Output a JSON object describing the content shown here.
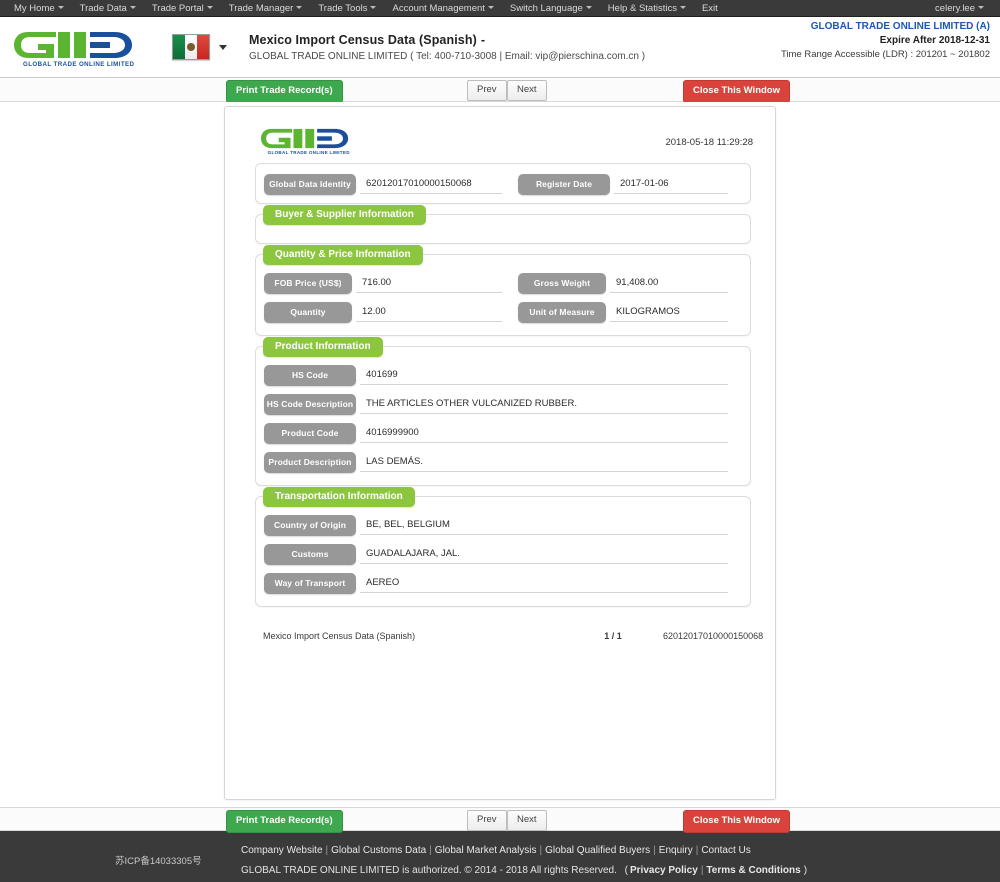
{
  "topnav": {
    "items": [
      {
        "label": "My Home",
        "caret": true
      },
      {
        "label": "Trade Data",
        "caret": true
      },
      {
        "label": "Trade Portal",
        "caret": true
      },
      {
        "label": "Trade Manager",
        "caret": true
      },
      {
        "label": "Trade Tools",
        "caret": true
      },
      {
        "label": "Account Management",
        "caret": true
      },
      {
        "label": "Switch Language",
        "caret": true
      },
      {
        "label": "Help & Statistics",
        "caret": true
      },
      {
        "label": "Exit",
        "caret": false
      }
    ],
    "user": "celery.lee"
  },
  "header": {
    "logo_text": "GLOBAL TRADE ONLINE LIMITED",
    "flag": "mexico-flag",
    "title": "Mexico Import Census Data (Spanish)",
    "title_dash": "-",
    "subtitle": "GLOBAL TRADE ONLINE LIMITED ( Tel: 400-710-3008 | Email: vip@pierschina.com.cn )",
    "account_name": "GLOBAL TRADE ONLINE LIMITED (A)",
    "expire": "Expire After 2018-12-31",
    "time_range": "Time Range Accessible (LDR) : 201201 ~ 201802"
  },
  "toolbar": {
    "print_label": "Print Trade Record(s)",
    "prev_label": "Prev",
    "next_label": "Next",
    "close_label": "Close This Window"
  },
  "sheet": {
    "logo_text": "GLOBAL TRADE ONLINE LIMITED",
    "timestamp": "2018-05-18 11:29:28",
    "identity": {
      "id_label": "Global Data Identity",
      "id_value": "62012017010000150068",
      "date_label": "Register Date",
      "date_value": "2017-01-06"
    },
    "sections": [
      {
        "title": "Buyer & Supplier Information",
        "rows": []
      },
      {
        "title": "Quantity & Price Information",
        "rows": [
          [
            {
              "label": "FOB Price (US$)",
              "value": "716.00"
            },
            {
              "label": "Gross Weight",
              "value": "91,408.00"
            }
          ],
          [
            {
              "label": "Quantity",
              "value": "12.00"
            },
            {
              "label": "Unit of Measure",
              "value": "KILOGRAMOS"
            }
          ]
        ]
      },
      {
        "title": "Product Information",
        "rows": [
          [
            {
              "label": "HS Code",
              "value": "401699"
            }
          ],
          [
            {
              "label": "HS Code Description",
              "value": "THE ARTICLES OTHER VULCANIZED RUBBER."
            }
          ],
          [
            {
              "label": "Product Code",
              "value": "4016999900"
            }
          ],
          [
            {
              "label": "Product Description",
              "value": "LAS DEMÁS."
            }
          ]
        ]
      },
      {
        "title": "Transportation Information",
        "rows": [
          [
            {
              "label": "Country of Origin",
              "value": "BE, BEL, BELGIUM"
            }
          ],
          [
            {
              "label": "Customs",
              "value": "GUADALAJARA, JAL."
            }
          ],
          [
            {
              "label": "Way of Transport",
              "value": "AEREO"
            }
          ]
        ]
      }
    ],
    "footer": {
      "source": "Mexico Import Census Data (Spanish)",
      "page": "1 / 1",
      "identity": "62012017010000150068"
    }
  },
  "footer": {
    "icp": "苏ICP备14033305号",
    "links": [
      "Company Website",
      "Global Customs Data",
      "Global Market Analysis",
      "Global Qualified Buyers",
      "Enquiry",
      "Contact Us"
    ],
    "copyright": "GLOBAL TRADE ONLINE LIMITED is authorized. © 2014 - 2018 All rights Reserved.",
    "legal_open": "(",
    "privacy": "Privacy Policy",
    "legal_sep": "|",
    "terms": "Terms & Conditions",
    "legal_close": ")"
  },
  "colors": {
    "green": "#8cc63e",
    "print_green": "#3ea84f",
    "close_red": "#d9433b",
    "pill_gray": "#989898",
    "nav_dark": "#3a3a3a",
    "account_blue": "#1a58b8"
  }
}
